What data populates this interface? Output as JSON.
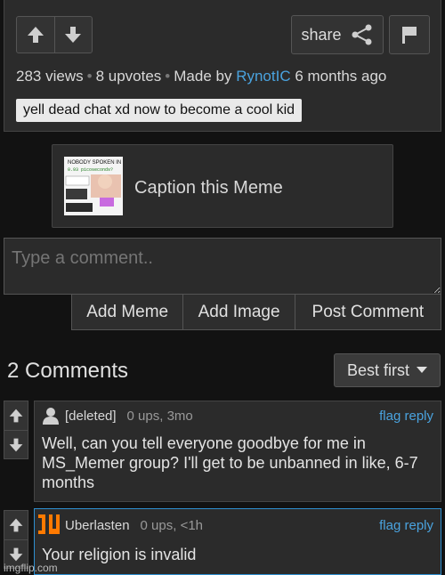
{
  "post": {
    "share_label": "share",
    "views": "283 views",
    "upvotes": "8 upvotes",
    "made_by_label": "Made by",
    "author": "RynotIC",
    "time": "6 months ago",
    "tag": "yell dead chat xd now to become a cool kid"
  },
  "caption": {
    "label": "Caption this Meme",
    "thumb_lines": [
      "NOBODY SPOKEN IN",
      "0.93 picoseconds?"
    ]
  },
  "comment_form": {
    "placeholder": "Type a comment..",
    "add_meme": "Add Meme",
    "add_image": "Add Image",
    "post_comment": "Post Comment"
  },
  "comments_header": {
    "title": "2 Comments",
    "sort_selected": "Best first"
  },
  "comments": [
    {
      "user": "[deleted]",
      "meta": "0 ups, 3mo",
      "flag": "flag",
      "reply": "reply",
      "body": "Well, can you tell everyone goodbye for me in MS_Memer group? I'll get to be unbanned in like, 6-7 months"
    },
    {
      "user": "Uberlasten",
      "meta": "0 ups, <1h",
      "flag": "flag",
      "reply": "reply",
      "body": "Your religion is invalid"
    }
  ],
  "watermark": "imgflip.com",
  "colors": {
    "background": "#121212",
    "panel": "#2b2b2b",
    "link": "#4aa3df",
    "highlight_border": "#2e8fd0",
    "uberlasten_avatar": "#ff7a00"
  }
}
